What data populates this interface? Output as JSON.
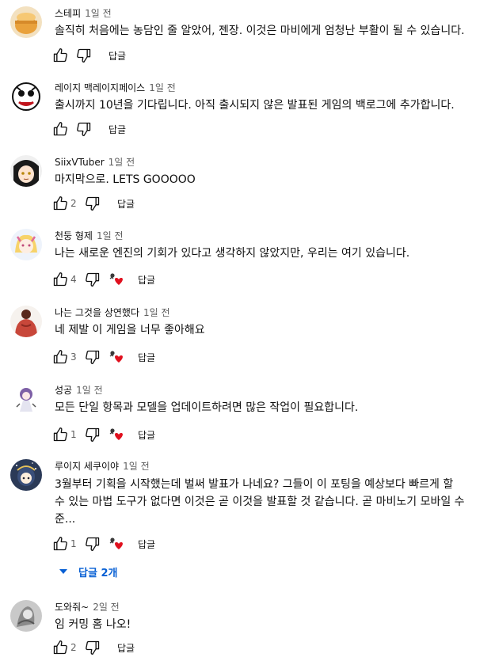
{
  "colors": {
    "link": "#065fd4",
    "heart": "#e0101e",
    "secondary_text": "#606060"
  },
  "icons": {
    "like": "thumb-up-icon",
    "dislike": "thumb-down-icon",
    "hearted": "heart-icon"
  },
  "comments": [
    {
      "author": "스테피",
      "time": "1일 전",
      "lines": [
        "솔직히 처음에는 농담인 줄 알았어, 젠장. 이것은 마비에게 엄청난 부활이 될 수 있습니다."
      ],
      "likes": "",
      "hearted": false,
      "reply": "답글"
    },
    {
      "author": "레이지 맥레이지페이스",
      "time": "1일 전",
      "lines": [
        "출시까지 10년을 기다립니다. 아직 출시되지 않은 발표된 게임의 백로그에 추가합니다."
      ],
      "likes": "",
      "hearted": false,
      "reply": "답글"
    },
    {
      "author": "SiixVTuber",
      "time": "1일 전",
      "lines": [
        "마지막으로. LETS GOOOOO"
      ],
      "likes": "2",
      "hearted": false,
      "reply": "답글"
    },
    {
      "author": "천둥 형제",
      "time": "1일 전",
      "lines": [
        "나는 새로운 엔진의 기회가 있다고 생각하지 않았지만, 우리는 여기 있습니다."
      ],
      "likes": "4",
      "hearted": true,
      "reply": "답글"
    },
    {
      "author": "나는 그것을 상연했다",
      "time": "1일 전",
      "lines": [
        "네 제발 이 게임을 너무 좋아해요"
      ],
      "likes": "3",
      "hearted": true,
      "reply": "답글"
    },
    {
      "author": "성공",
      "time": "1일 전",
      "lines": [
        "모든 단일 항목과 모델을 업데이트하려면 많은 작업이 필요합니다."
      ],
      "likes": "1",
      "hearted": true,
      "reply": "답글"
    },
    {
      "author": "루이지 세쿠이야",
      "time": "1일 전",
      "lines": [
        "3월부터 기획을 시작했는데 벌써 발표가 나네요? 그들이 이 포팅을 예상보다 빠르게 할",
        "수 있는 마법 도구가 없다면 이것은 곧 이것을 발표할 것 같습니다. 곧 마비노기 모바일 수",
        "준..."
      ],
      "likes": "1",
      "hearted": true,
      "reply": "답글"
    },
    {
      "author": "도와줘~",
      "time": "2일 전",
      "lines": [
        "임 커밍 홈 나오!"
      ],
      "likes": "2",
      "hearted": false,
      "reply": "답글"
    }
  ],
  "replies_toggle": {
    "label": "답글 2개"
  }
}
